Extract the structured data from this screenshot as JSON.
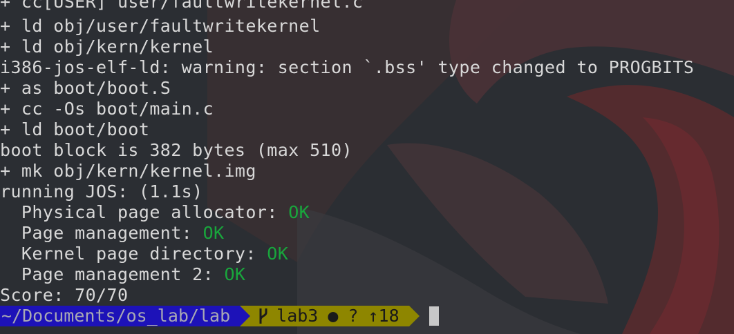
{
  "terminal": {
    "lines": [
      "+ cc[USER] user/faultwritekernel.c",
      "+ ld obj/user/faultwritekernel",
      "+ ld obj/kern/kernel",
      "i386-jos-elf-ld: warning: section `.bss' type changed to PROGBITS",
      "+ as boot/boot.S",
      "+ cc -Os boot/main.c",
      "+ ld boot/boot",
      "boot block is 382 bytes (max 510)",
      "+ mk obj/kern/kernel.img",
      "running JOS: (1.1s)"
    ],
    "grades": [
      {
        "label": "  Physical page allocator: ",
        "status": "OK"
      },
      {
        "label": "  Page management: ",
        "status": "OK"
      },
      {
        "label": "  Kernel page directory: ",
        "status": "OK"
      },
      {
        "label": "  Page management 2: ",
        "status": "OK"
      }
    ],
    "score": "Score: 70/70"
  },
  "prompt": {
    "cwd": "~/Documents/os_lab/lab",
    "branch_icon": "git-branch-icon",
    "branch": "lab3",
    "dirty_marker": "●",
    "untracked_marker": "?",
    "ahead": "↑18"
  },
  "colors": {
    "ok": "#19a63c",
    "cwd_bg": "#1d12b8",
    "git_bg": "#8e8600",
    "text": "#d8d8d8"
  }
}
